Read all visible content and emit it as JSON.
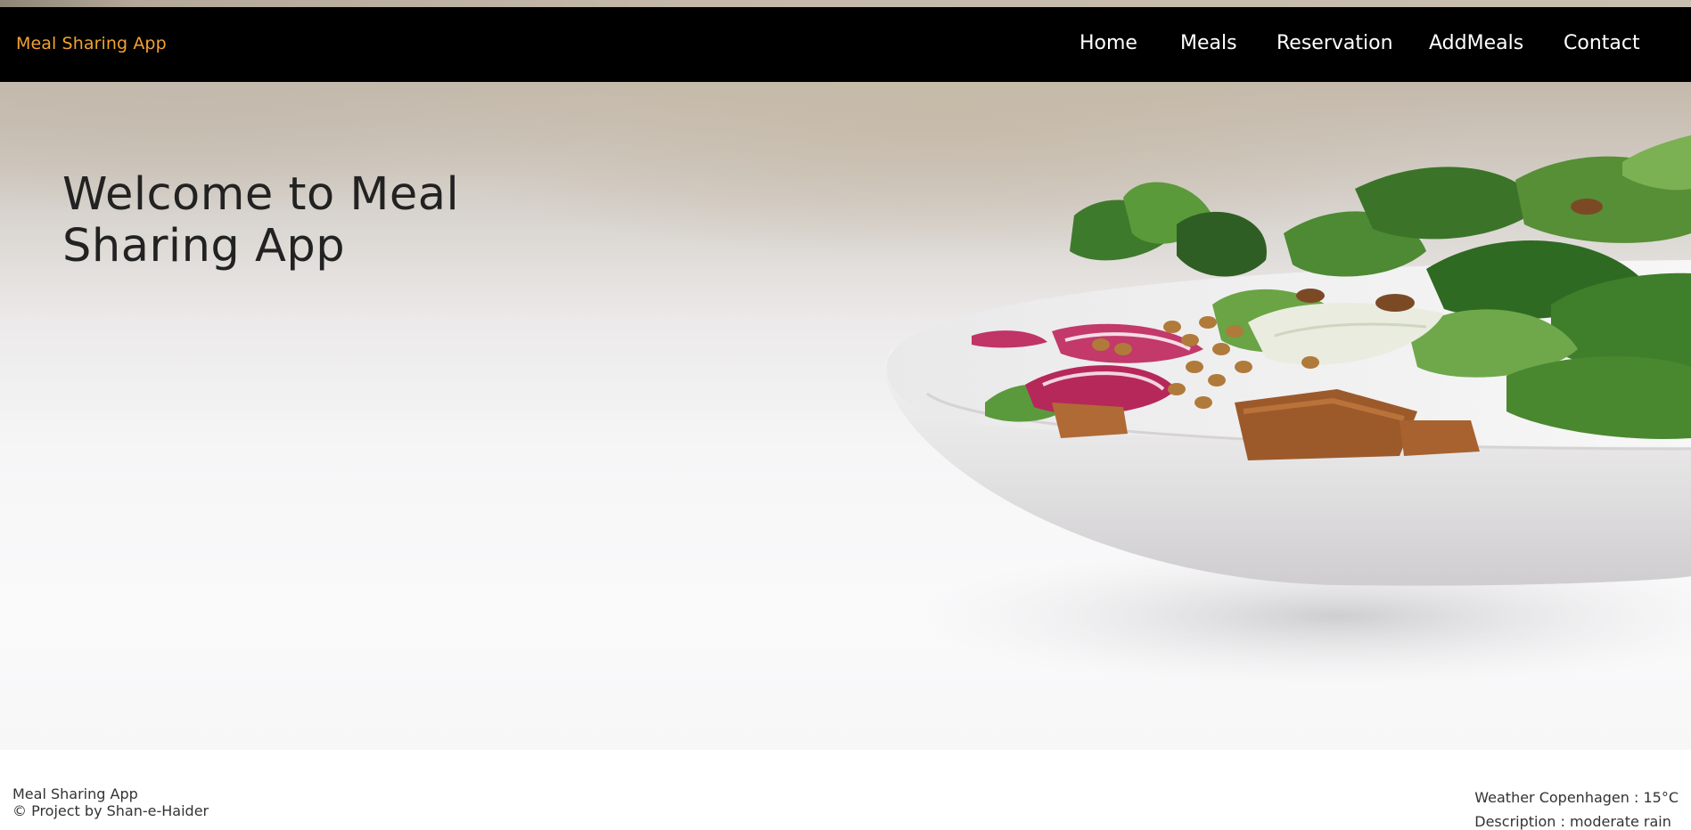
{
  "header": {
    "brand": "Meal Sharing App",
    "brand_color": "#f2a230",
    "nav": [
      {
        "label": "Home"
      },
      {
        "label": "Meals"
      },
      {
        "label": "Reservation"
      },
      {
        "label": "AddMeals"
      },
      {
        "label": "Contact"
      }
    ]
  },
  "hero": {
    "title": "Welcome to Meal Sharing App",
    "image": "salad-bowl-image"
  },
  "footer": {
    "app_name": "Meal Sharing App",
    "credit": "© Project by Shan-e-Haider",
    "weather": "Weather Copenhagen : 15°C",
    "description": "Description : moderate rain"
  }
}
